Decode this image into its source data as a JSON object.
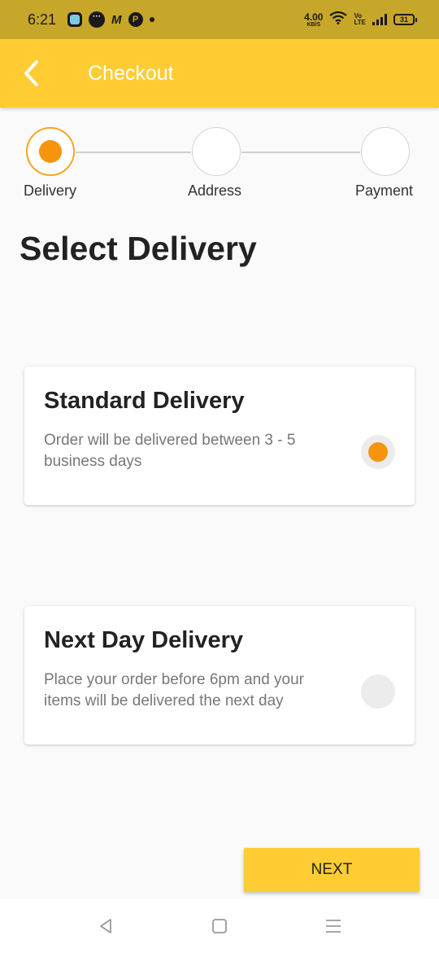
{
  "status_bar": {
    "time": "6:21",
    "notif_m": "M",
    "notif_p": "P",
    "net_speed_value": "4.00",
    "net_speed_unit": "KB/S",
    "volte_top": "Vo",
    "volte_bottom": "LTE",
    "battery": "31"
  },
  "app_bar": {
    "title": "Checkout",
    "icon_color": "#ffffff",
    "background": "#ffcc33"
  },
  "stepper": {
    "steps": [
      {
        "label": "Delivery",
        "active": true
      },
      {
        "label": "Address",
        "active": false
      },
      {
        "label": "Payment",
        "active": false
      }
    ],
    "accent": "#f7940d"
  },
  "main": {
    "heading": "Select Delivery",
    "options": [
      {
        "title": "Standard Delivery",
        "description": "Order will be delivered between 3 - 5 business days",
        "selected": true
      },
      {
        "title": "Next Day Delivery",
        "description": "Place your order before 6pm and your items will be delivered the next day",
        "selected": false
      }
    ],
    "next_label": "NEXT"
  },
  "nav_bar": {
    "icons": [
      "back-triangle-icon",
      "home-square-icon",
      "recents-menu-icon"
    ]
  }
}
